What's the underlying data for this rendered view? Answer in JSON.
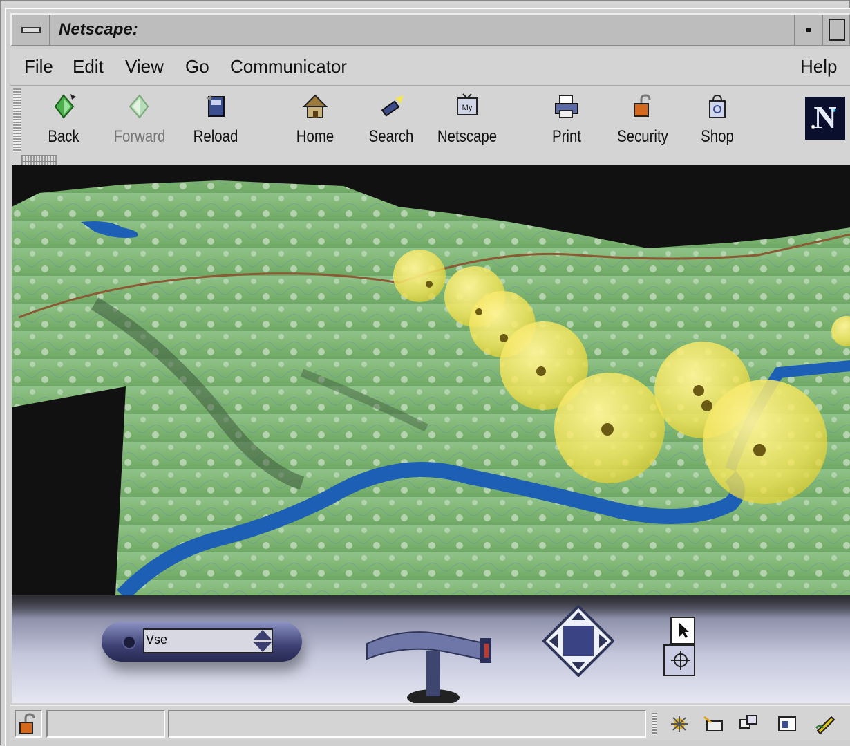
{
  "window": {
    "title": "Netscape:"
  },
  "menubar": {
    "file": "File",
    "edit": "Edit",
    "view": "View",
    "go": "Go",
    "communicator": "Communicator",
    "help": "Help"
  },
  "toolbar": {
    "back": "Back",
    "forward": "Forward",
    "reload": "Reload",
    "home": "Home",
    "search": "Search",
    "netscape": "Netscape",
    "print": "Print",
    "security": "Security",
    "shop": "Shop",
    "logo_letter": "N",
    "my_badge": "My"
  },
  "vrml_controls": {
    "viewpoint_value": "Vse"
  },
  "statusbar": {
    "progress_text": "",
    "status_text": ""
  },
  "colors": {
    "terrain_green": "#8cbf7a",
    "river_blue": "#1d5fb5",
    "marker_yellow": "#f3e356",
    "control_purple": "#3d4174"
  },
  "icons": {
    "back": "green-arrow-left-icon",
    "forward": "green-arrow-right-icon",
    "reload": "reload-icon",
    "home": "house-icon",
    "search": "flashlight-icon",
    "netscape": "my-netscape-tv-icon",
    "print": "printer-icon",
    "security": "padlock-icon",
    "shop": "shopping-bag-icon"
  }
}
